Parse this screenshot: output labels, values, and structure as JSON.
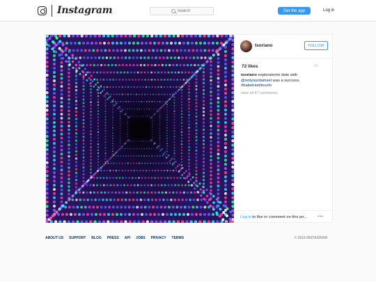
{
  "header": {
    "wordmark": "Instagram",
    "search_placeholder": "Search",
    "get_app_label": "Get the app",
    "login_label": "Log in"
  },
  "post": {
    "username": "tsoriano",
    "follow_label": "FOLLOW",
    "likes": "72 likes",
    "time": "1h",
    "caption": {
      "username": "tsoriano",
      "text1": " exploratorim date with ",
      "mention": "@notyourdamsel",
      "text2": " was a success. ",
      "hashtag": "#babehamlincoln"
    },
    "view_all": "view all 47 comments",
    "login_link": "Log in",
    "login_rest": " to like or comment on this po...",
    "more_icon": "•••"
  },
  "footer": {
    "links": [
      "ABOUT US",
      "SUPPORT",
      "BLOG",
      "PRESS",
      "API",
      "JOBS",
      "PRIVACY",
      "TERMS"
    ],
    "copyright": "© 2019 INSTAGRAM"
  },
  "colors": {
    "accent": "#3897f0",
    "link": "#003569",
    "lights": [
      "#4f6dff",
      "#7b5cff",
      "#ff3fb4",
      "#2fe6ff",
      "#ffffff",
      "#b25cff",
      "#ff5a8c",
      "#5ad1ff",
      "#3aff9a"
    ]
  }
}
